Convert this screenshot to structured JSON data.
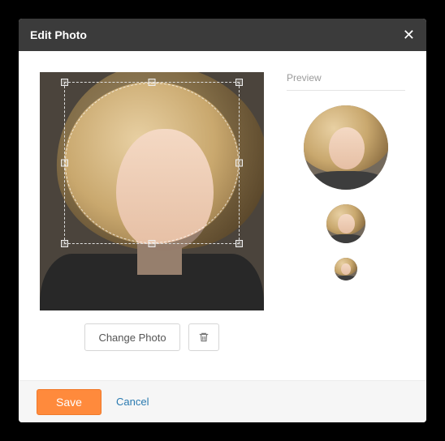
{
  "modal": {
    "title": "Edit Photo",
    "close_aria": "Close"
  },
  "editor": {
    "change_photo_label": "Change Photo",
    "delete_aria": "Delete photo"
  },
  "preview": {
    "label": "Preview"
  },
  "footer": {
    "save_label": "Save",
    "cancel_label": "Cancel"
  }
}
